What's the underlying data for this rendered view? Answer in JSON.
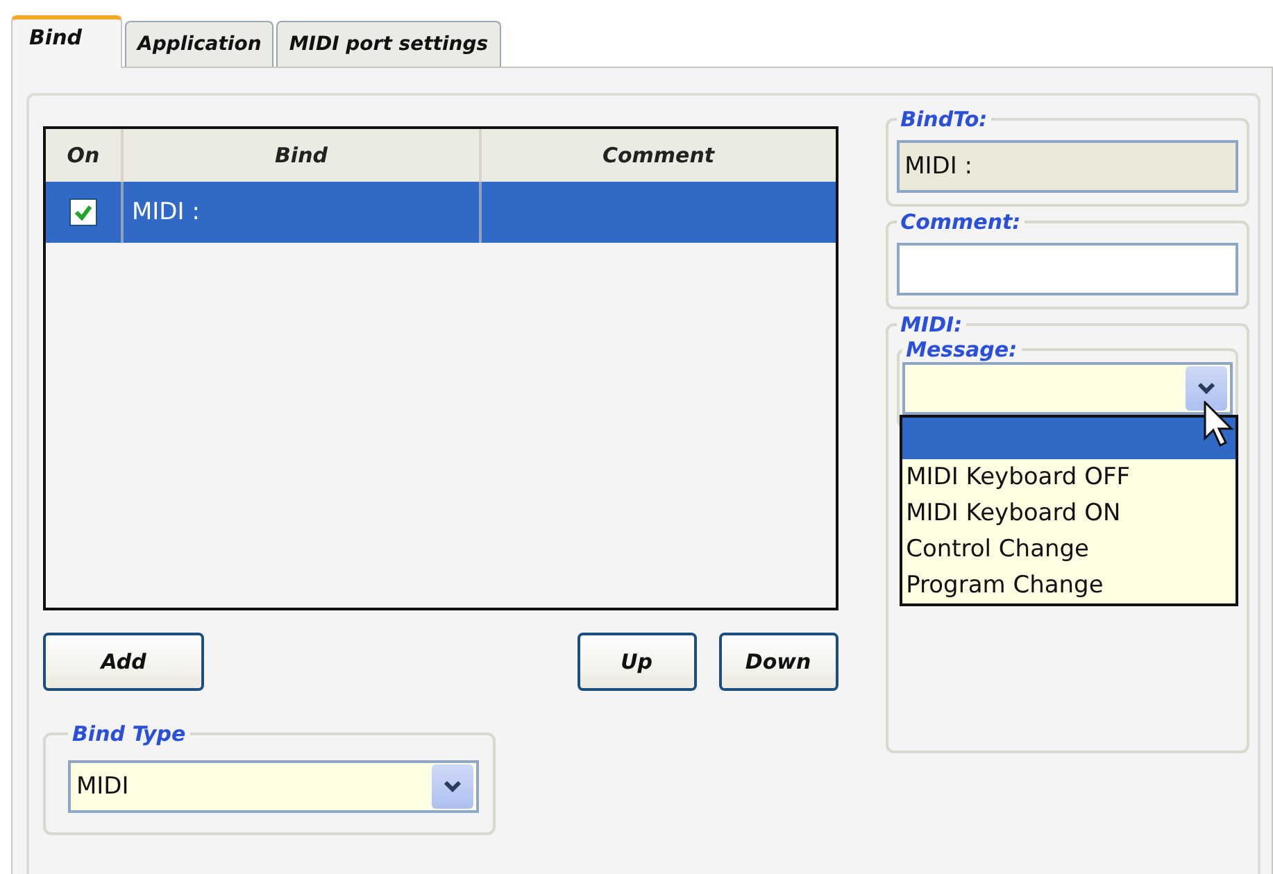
{
  "tabs": [
    {
      "label": "Bind",
      "selected": true
    },
    {
      "label": "Application",
      "selected": false
    },
    {
      "label": "MIDI port settings",
      "selected": false
    }
  ],
  "grid": {
    "columns": [
      "On",
      "Bind",
      "Comment"
    ],
    "rows": [
      {
        "on": true,
        "bind": "MIDI :",
        "selected": true
      }
    ]
  },
  "buttons": [
    {
      "label": "Add"
    },
    {
      "label": "Up"
    },
    {
      "label": "Down"
    }
  ],
  "bind_type": {
    "legend": "Bind Type",
    "value": "MIDI"
  },
  "bind_to": {
    "legend": "BindTo:",
    "value": "MIDI :"
  },
  "comment": {
    "legend": "Comment:"
  },
  "midi": {
    "legend": "MIDI:",
    "message": {
      "legend": "Message:",
      "expanded": true,
      "blank_option_highlighted": true,
      "options": [
        {
          "label": "MIDI Keyboard OFF",
          "selected": false
        },
        {
          "label": "MIDI Keyboard ON",
          "selected": false
        },
        {
          "label": "Control Change",
          "selected": false
        },
        {
          "label": "Program Change",
          "selected": false
        }
      ]
    }
  }
}
